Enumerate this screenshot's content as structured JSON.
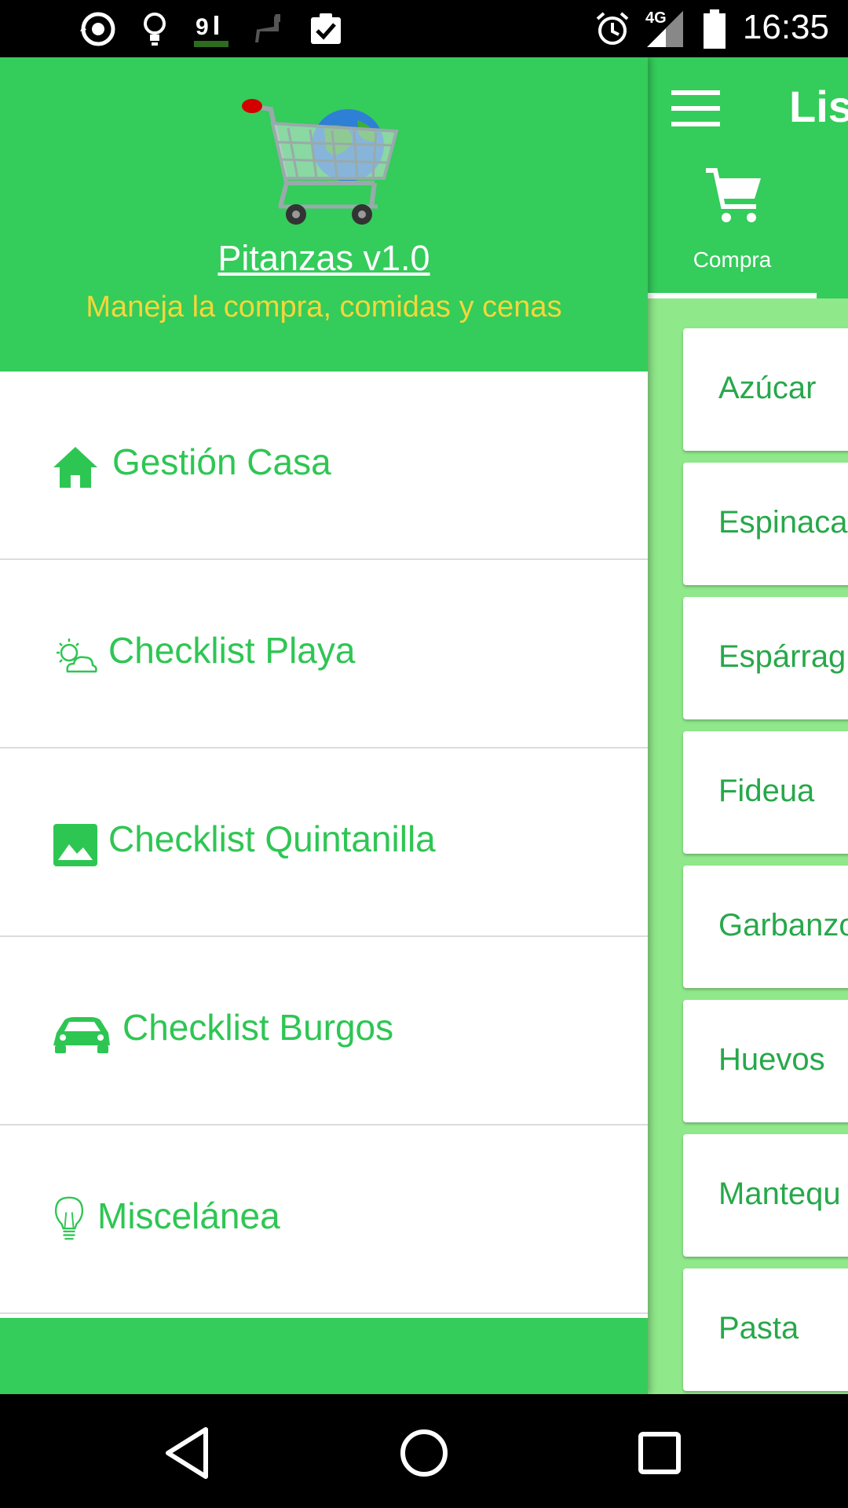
{
  "status_bar": {
    "time": "16:35",
    "network": "4G",
    "icons": [
      "sync-icon",
      "lightbulb-icon",
      "signal-meter-icon",
      "llama-icon",
      "clipboard-check-icon",
      "alarm-icon",
      "cell-signal-icon",
      "battery-icon"
    ]
  },
  "main": {
    "title": "Lis",
    "tab": {
      "label": "Compra",
      "icon": "cart-icon"
    },
    "items": [
      "Azúcar",
      "Espinaca",
      "Espárrag",
      "Fideua",
      "Garbanzo",
      "Huevos",
      "Mantequ",
      "Pasta"
    ]
  },
  "drawer": {
    "app_name": "Pitanzas v1.0",
    "subtitle": "Maneja la compra, comidas y cenas",
    "menu": [
      {
        "label": "Gestión Casa",
        "icon": "home-icon"
      },
      {
        "label": "Checklist Playa",
        "icon": "sun-cloud-icon"
      },
      {
        "label": "Checklist Quintanilla",
        "icon": "image-icon"
      },
      {
        "label": "Checklist Burgos",
        "icon": "car-icon"
      },
      {
        "label": "Miscelánea",
        "icon": "lightbulb-icon"
      }
    ]
  },
  "colors": {
    "green": "#34cc5b",
    "light_green": "#8fe88a",
    "text_green": "#2ec653",
    "yellow": "#f5d73a"
  },
  "nav_bar": {
    "icons": [
      "back-icon",
      "home-circle-icon",
      "recents-icon"
    ]
  }
}
